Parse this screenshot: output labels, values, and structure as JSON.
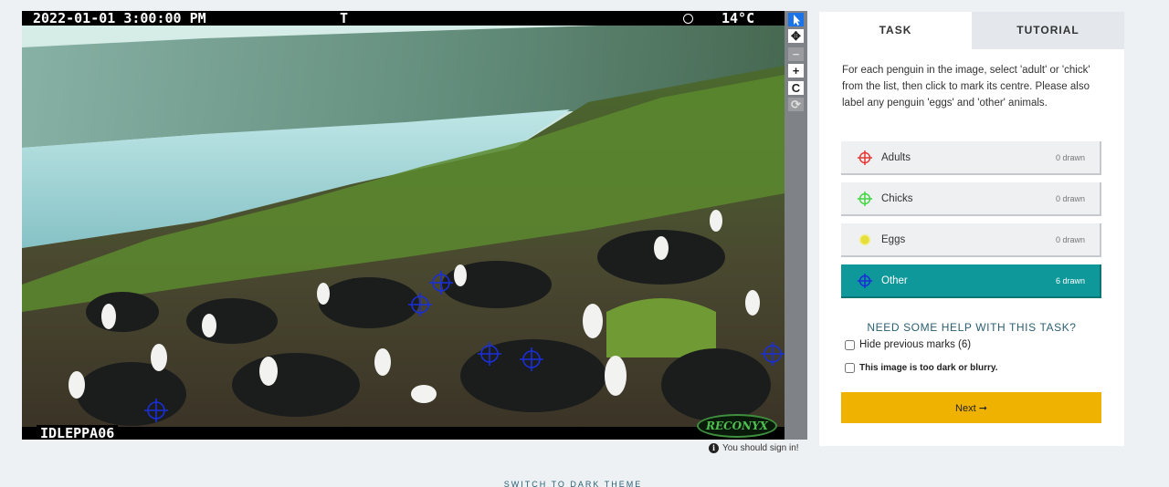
{
  "image": {
    "timestamp": "2022-01-01 3:00:00 PM",
    "flag": "T",
    "temperature": "14°C",
    "camera_id": "IDLEPPA06",
    "brand": "RECONYX"
  },
  "viewer_tools": [
    "pointer-icon",
    "move-icon",
    "zoom-out-icon",
    "zoom-in-icon",
    "rotate-icon",
    "reset-icon"
  ],
  "marks": [
    {
      "tool": "Other",
      "color": "#2233cc"
    },
    {
      "tool": "Other",
      "color": "#2233cc"
    },
    {
      "tool": "Other",
      "color": "#2233cc"
    },
    {
      "tool": "Other",
      "color": "#2233cc"
    },
    {
      "tool": "Other",
      "color": "#2233cc"
    },
    {
      "tool": "Other",
      "color": "#2233cc"
    }
  ],
  "signin_notice": "You should sign in!",
  "task": {
    "tabs": [
      "TASK",
      "TUTORIAL"
    ],
    "instructions": "For each penguin in the image, select 'adult' or 'chick' from the list, then click to mark its centre. Please also label any penguin 'eggs' and 'other' animals.",
    "tools": [
      {
        "label": "Adults",
        "count": "0 drawn",
        "color": "#e53935",
        "icon": "crosshair-icon"
      },
      {
        "label": "Chicks",
        "count": "0 drawn",
        "color": "#43d643",
        "icon": "crosshair-icon"
      },
      {
        "label": "Eggs",
        "count": "0 drawn",
        "color": "#e6df3a",
        "icon": "dot-icon"
      },
      {
        "label": "Other",
        "count": "6 drawn",
        "color": "#1a2ed8",
        "icon": "crosshair-icon"
      }
    ],
    "help_link": "NEED SOME HELP WITH THIS TASK?",
    "hide_marks_label": "Hide previous marks (6)",
    "too_dark_label": "This image is too dark or blurry.",
    "next_label": "Next ➞"
  },
  "theme_toggle": "SWITCH TO DARK THEME"
}
